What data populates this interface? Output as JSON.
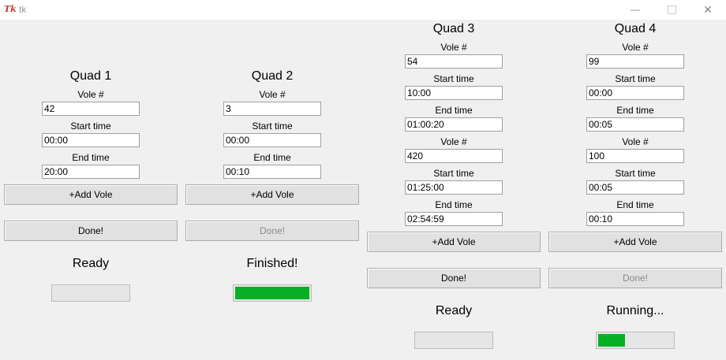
{
  "window": {
    "title": "tk",
    "icon_text": "Tk"
  },
  "quads": [
    {
      "title": "Quad 1",
      "voles": [
        {
          "vole_label": "Vole #",
          "vole_value": "42",
          "start_label": "Start time",
          "start_value": "00:00",
          "end_label": "End time",
          "end_value": "20:00"
        }
      ],
      "add_label": "+Add Vole",
      "done_label": "Done!",
      "done_disabled": false,
      "status": "Ready",
      "progress": 0
    },
    {
      "title": "Quad 2",
      "voles": [
        {
          "vole_label": "Vole #",
          "vole_value": "3",
          "start_label": "Start time",
          "start_value": "00:00",
          "end_label": "End time",
          "end_value": "00:10"
        }
      ],
      "add_label": "+Add Vole",
      "done_label": "Done!",
      "done_disabled": true,
      "status": "Finished!",
      "progress": 1.0
    },
    {
      "title": "Quad 3",
      "voles": [
        {
          "vole_label": "Vole #",
          "vole_value": "54",
          "start_label": "Start time",
          "start_value": "10:00",
          "end_label": "End time",
          "end_value": "01:00:20"
        },
        {
          "vole_label": "Vole #",
          "vole_value": "420",
          "start_label": "Start time",
          "start_value": "01:25:00",
          "end_label": "End time",
          "end_value": "02:54:59"
        }
      ],
      "add_label": "+Add Vole",
      "done_label": "Done!",
      "done_disabled": false,
      "status": "Ready",
      "progress": 0
    },
    {
      "title": "Quad 4",
      "voles": [
        {
          "vole_label": "Vole #",
          "vole_value": "99",
          "start_label": "Start time",
          "start_value": "00:00",
          "end_label": "End time",
          "end_value": "00:05"
        },
        {
          "vole_label": "Vole #",
          "vole_value": "100",
          "start_label": "Start time",
          "start_value": "00:05",
          "end_label": "End time",
          "end_value": "00:10"
        }
      ],
      "add_label": "+Add Vole",
      "done_label": "Done!",
      "done_disabled": true,
      "status": "Running...",
      "progress": 0.36
    }
  ],
  "colors": {
    "progress_fill": "#06b025",
    "disabled_text": "#8a8a8a"
  }
}
